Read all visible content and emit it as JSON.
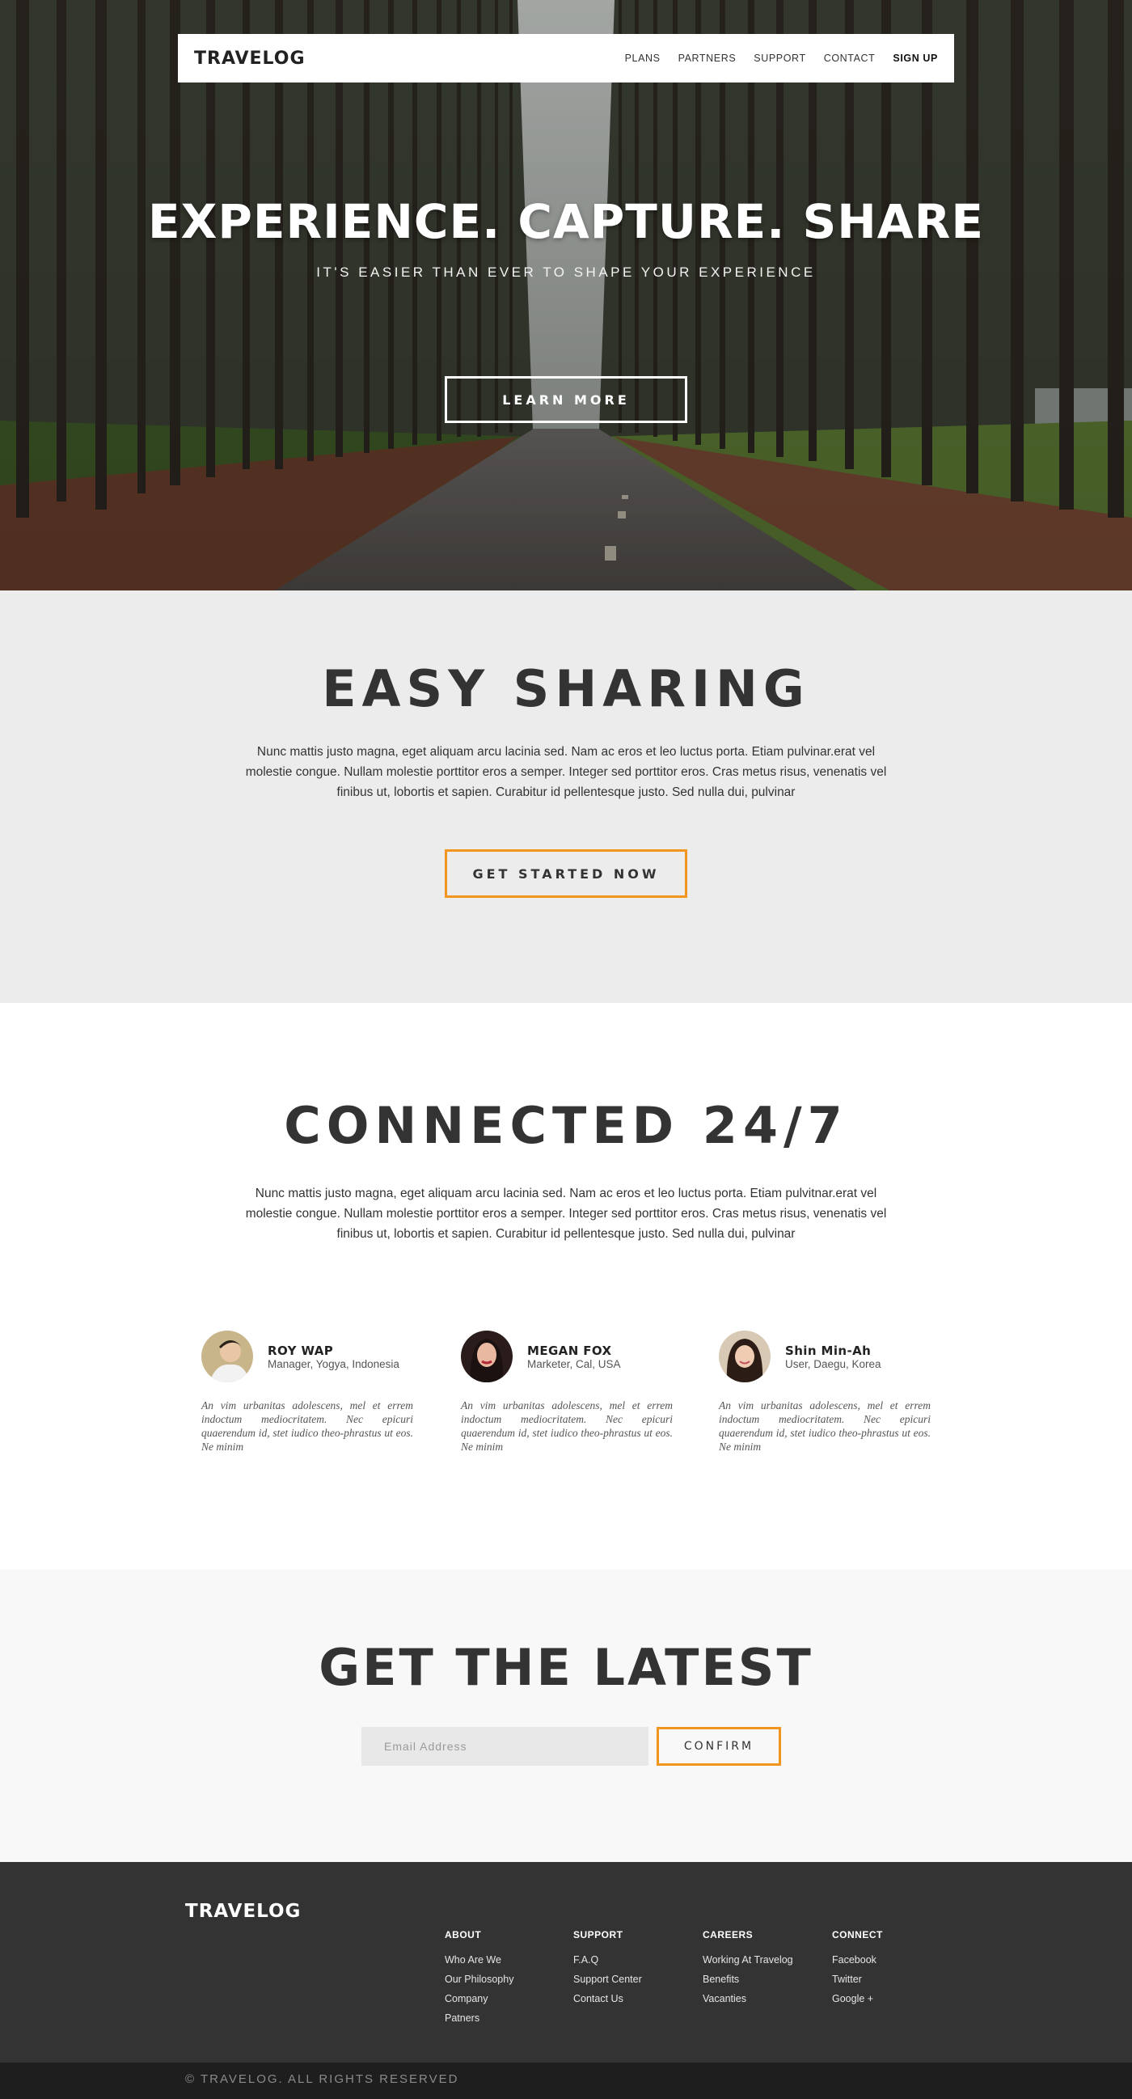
{
  "colors": {
    "accent": "#f0961e",
    "dark": "#333333",
    "footer_bottom": "#1e1e1e",
    "light_bg": "#ececec"
  },
  "nav": {
    "brand": "TRAVELOG",
    "links": [
      "PLANS",
      "PARTNERS",
      "SUPPORT",
      "CONTACT",
      "SIGN UP"
    ]
  },
  "hero": {
    "title": "EXPERIENCE. CAPTURE. SHARE",
    "subtitle": "IT'S EASIER THAN EVER TO SHAPE YOUR EXPERIENCE",
    "cta": "LEARN MORE"
  },
  "sharing": {
    "title": "EASY SHARING",
    "text": "Nunc mattis justo magna, eget aliquam arcu lacinia sed. Nam ac eros et leo luctus porta. Etiam pulvinar.erat vel molestie congue. Nullam molestie porttitor eros a semper. Integer sed porttitor eros. Cras metus risus, venenatis vel finibus ut, lobortis et sapien. Curabitur id pellentesque justo. Sed nulla dui, pulvinar",
    "cta": "GET STARTED NOW"
  },
  "connected": {
    "title": "CONNECTED 24/7",
    "text": "Nunc mattis justo magna, eget aliquam arcu lacinia sed. Nam ac eros et leo luctus porta. Etiam pulvitnar.erat vel molestie congue. Nullam molestie porttitor eros a semper. Integer sed porttitor eros. Cras metus risus, venenatis vel finibus ut, lobortis et sapien. Curabitur id pellentesque justo. Sed nulla dui, pulvinar",
    "testimonials": [
      {
        "name": "ROY WAP",
        "role": "Manager, Yogya, Indonesia",
        "quote": "An vim urbanitas adolescens, mel et errem indoctum mediocritatem. Nec epicuri quaerendum id, stet iudico theo-phrastus ut eos. Ne minim"
      },
      {
        "name": "MEGAN FOX",
        "role": "Marketer, Cal, USA",
        "quote": "An vim urbanitas adolescens, mel et errem indoctum mediocritatem. Nec epicuri quaerendum id, stet iudico theo-phrastus ut eos. Ne minim"
      },
      {
        "name": "Shin Min-Ah",
        "role": "User, Daegu, Korea",
        "quote": "An vim urbanitas adolescens, mel et errem indoctum mediocritatem. Nec epicuri quaerendum id, stet iudico theo-phrastus ut eos. Ne minim"
      }
    ]
  },
  "latest": {
    "title": "GET THE LATEST",
    "email_placeholder": "Email Address",
    "confirm": "CONFIRM"
  },
  "footer": {
    "brand": "TRAVELOG",
    "columns": [
      {
        "heading": "ABOUT",
        "links": [
          "Who Are We",
          "Our Philosophy",
          "Company",
          "Patners"
        ]
      },
      {
        "heading": "SUPPORT",
        "links": [
          "F.A.Q",
          "Support Center",
          "Contact Us"
        ]
      },
      {
        "heading": "CAREERS",
        "links": [
          "Working At Travelog",
          "Benefits",
          "Vacanties"
        ]
      },
      {
        "heading": "CONNECT",
        "links": [
          "Facebook",
          "Twitter",
          "Google +"
        ]
      }
    ],
    "copyright": "© TRAVELOG. ALL RIGHTS RESERVED"
  }
}
